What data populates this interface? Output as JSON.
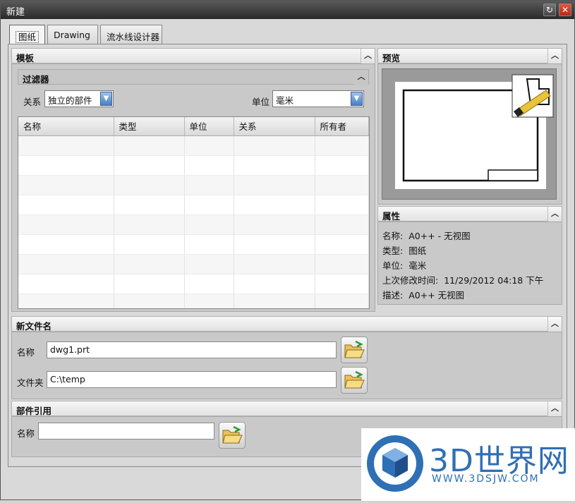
{
  "window": {
    "title": "新建"
  },
  "tabs": [
    {
      "label": "图纸",
      "active": true
    },
    {
      "label": "Drawing",
      "active": false
    },
    {
      "label": "流水线设计器",
      "active": false
    }
  ],
  "template_section": {
    "title": "模板",
    "filter": {
      "title": "过滤器",
      "relation_label": "关系",
      "relation_value": "独立的部件",
      "unit_label": "单位",
      "unit_value": "毫米"
    },
    "table": {
      "columns": [
        "名称",
        "类型",
        "单位",
        "关系",
        "所有者"
      ],
      "rows": []
    }
  },
  "preview": {
    "title": "预览"
  },
  "properties": {
    "title": "属性",
    "items": [
      {
        "key": "名称:",
        "value": "A0++ - 无视图"
      },
      {
        "key": "类型:",
        "value": "图纸"
      },
      {
        "key": "单位:",
        "value": "毫米"
      },
      {
        "key": "上次修改时间:",
        "value": "11/29/2012 04:18 下午"
      },
      {
        "key": "描述:",
        "value": "A0++ 无视图"
      }
    ]
  },
  "new_file": {
    "title": "新文件名",
    "name_label": "名称",
    "name_value": "dwg1.prt",
    "folder_label": "文件夹",
    "folder_value": "C:\\temp"
  },
  "part_ref": {
    "title": "部件引用",
    "name_label": "名称",
    "name_value": ""
  },
  "watermark": {
    "brand": "3D世界网",
    "url": "WWW.3DSJW.COM"
  },
  "colors": {
    "accent_blue": "#2f6fb5",
    "close_red": "#d8432a"
  }
}
